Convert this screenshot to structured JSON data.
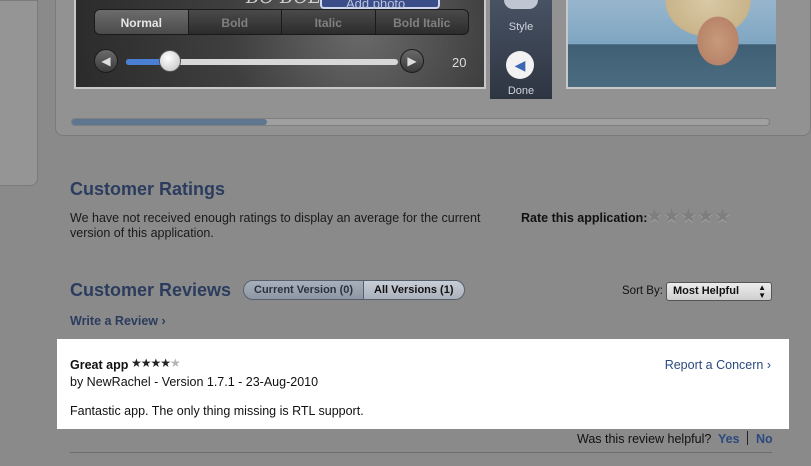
{
  "screenshots": {
    "top_ghost_text": "BO BOLD",
    "add_photo_label": "Add photo",
    "font_styles": [
      "Normal",
      "Bold",
      "Italic",
      "Bold Italic"
    ],
    "font_size_value": "20",
    "font_size_fraction": 0.16,
    "tool_labels": {
      "style": "Style",
      "done": "Done"
    },
    "scroll_fraction": 0.28
  },
  "ratings": {
    "title": "Customer Ratings",
    "message": "We have not received enough ratings to display an average for the current version of this application.",
    "rate_label": "Rate this application:",
    "rate_stars": "★★★★★"
  },
  "reviews": {
    "title": "Customer Reviews",
    "tabs": [
      {
        "label": "Current Version (0)",
        "active": false
      },
      {
        "label": "All Versions (1)",
        "active": true
      }
    ],
    "sort_label": "Sort By:",
    "sort_value": "Most Helpful",
    "write_review": "Write a Review ›",
    "items": [
      {
        "title": "Great app",
        "rating": 4,
        "stars_on": "★★★★",
        "stars_off": "★",
        "meta": "by NewRachel - Version 1.7.1 - 23-Aug-2010",
        "body": "Fantastic app. The only thing missing is RTL support.",
        "report": "Report a Concern ›"
      }
    ],
    "helpful_question": "Was this review helpful?",
    "helpful_yes": "Yes",
    "helpful_no": "No"
  },
  "colors": {
    "page_bg": "#8a8a8a",
    "heading": "#2b3c5e",
    "link": "#2b4a7e",
    "slider_fill": "#4a7fd6"
  }
}
